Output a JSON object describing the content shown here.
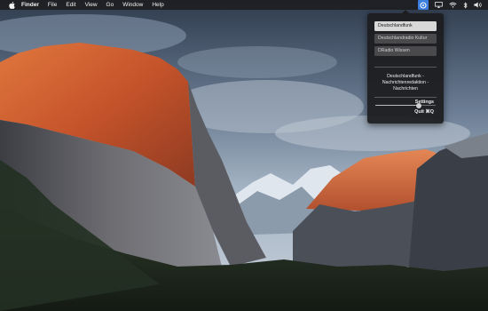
{
  "menubar": {
    "app_name": "Finder",
    "menus": [
      "File",
      "Edit",
      "View",
      "Go",
      "Window",
      "Help"
    ],
    "status_icons": [
      "radio-status-icon",
      "display-mirroring-icon",
      "wifi-icon",
      "bluetooth-icon",
      "volume-icon"
    ]
  },
  "popover": {
    "stations": [
      {
        "label": "Deutschlandfunk",
        "selected": true
      },
      {
        "label": "Deutschlandradio Kultur",
        "selected": false
      },
      {
        "label": "DRadio Wissen",
        "selected": false
      }
    ],
    "now_playing": {
      "line1": "Deutschlandfunk -",
      "line2": "Nachrichtenredaktion -",
      "line3": "Nachrichten"
    },
    "volume": 0.72,
    "settings_label": "Settings",
    "quit_label": "Quit ⌘Q"
  },
  "colors": {
    "menubar_bg": "#1e1e22",
    "popover_bg": "#1c1c1e",
    "accent": "#3a7ee0",
    "rock_orange": "#c8562a"
  }
}
